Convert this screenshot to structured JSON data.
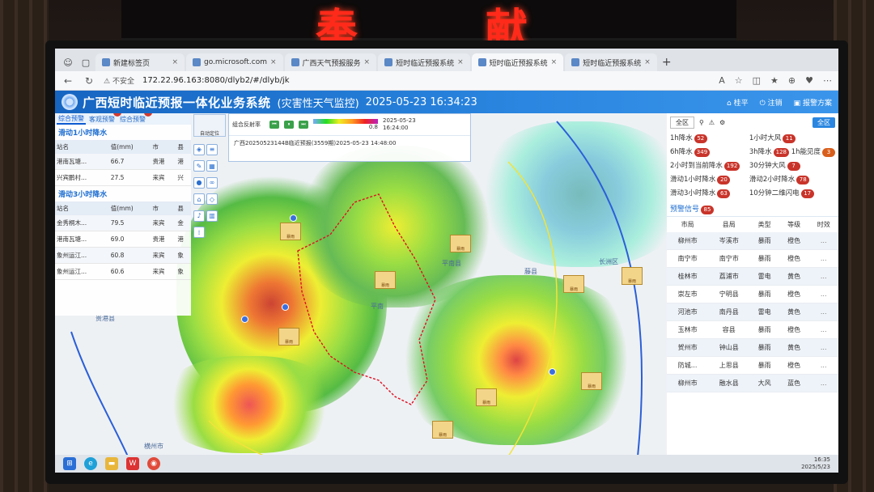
{
  "led": {
    "chars": [
      "奉",
      "献"
    ]
  },
  "browser": {
    "tabs": [
      {
        "label": "新建标签页",
        "active": false
      },
      {
        "label": "go.microsoft.com",
        "active": false
      },
      {
        "label": "广西天气预报服务",
        "active": false
      },
      {
        "label": "短时临近预报系统",
        "active": false
      },
      {
        "label": "短时临近预报系统",
        "active": true
      },
      {
        "label": "短时临近预报系统",
        "active": false
      }
    ],
    "insecure_label": "不安全",
    "url": "172.22.96.163:8080/dlyb2/#/dlyb/jk"
  },
  "header": {
    "title": "广西短时临近预报一体化业务系统",
    "subtitle": "(灾害性天气监控)",
    "datetime": "2025-05-23 16:34:23",
    "right_items": [
      "桂平",
      "注销",
      "报警方案"
    ]
  },
  "left": {
    "tabs": [
      {
        "label": "综合预警",
        "badge": ""
      },
      {
        "label": "客观预警",
        "badge": "0"
      },
      {
        "label": "综合预警",
        "badge": "2"
      }
    ],
    "section1": {
      "title": "滑动1小时降水",
      "columns": [
        "站名",
        "值(mm)",
        "市",
        "县"
      ],
      "rows": [
        [
          "港南瓦塘...",
          "66.7",
          "贵港",
          "港"
        ],
        [
          "兴宾鹏村...",
          "27.5",
          "来宾",
          "兴"
        ]
      ]
    },
    "section2": {
      "title": "滑动3小时降水",
      "columns": [
        "站名",
        "值(mm)",
        "市",
        "县"
      ],
      "rows": [
        [
          "金秀桐木...",
          "79.5",
          "来宾",
          "金"
        ],
        [
          "港南瓦塘...",
          "69.0",
          "贵港",
          "港"
        ],
        [
          "象州运江...",
          "60.8",
          "来宾",
          "象"
        ],
        [
          "象州运江...",
          "60.6",
          "来宾",
          "象"
        ]
      ]
    }
  },
  "radar": {
    "thumb_label": "自动定位",
    "label": "组合反射率",
    "opacity": "0.8",
    "date": "2025-05-23",
    "time": "16:24:00",
    "info": "广西20250523144B临近预报(3559期)2025-05-23 14:48:00"
  },
  "right": {
    "filter_label": "全区",
    "all_button": "全区",
    "warnings": [
      {
        "label": "1h降水",
        "count": "52"
      },
      {
        "label": "1小时大风",
        "count": "11"
      },
      {
        "label": "6h降水",
        "count": "349"
      },
      {
        "label": "3h降水",
        "count": "128"
      },
      {
        "label": "1h能见度",
        "count": "3"
      },
      {
        "label": "2小时到当前降水",
        "count": "192"
      },
      {
        "label": "30分钟大风",
        "count": "7"
      },
      {
        "label": "滑动1小时降水",
        "count": "20"
      },
      {
        "label": "滑动2小时降水",
        "count": "78"
      },
      {
        "label": "滑动3小时降水",
        "count": "63"
      },
      {
        "label": "10分钟二维闪电",
        "count": "17"
      },
      {
        "label": "预警信号",
        "count": "85"
      }
    ],
    "table": {
      "columns": [
        "市局",
        "县局",
        "类型",
        "等级",
        "时效"
      ],
      "rows": [
        [
          "柳州市",
          "岑溪市",
          "暴雨",
          "橙色",
          "..."
        ],
        [
          "南宁市",
          "南宁市",
          "暴雨",
          "橙色",
          "..."
        ],
        [
          "桂林市",
          "荔浦市",
          "雷电",
          "黄色",
          "..."
        ],
        [
          "崇左市",
          "宁明县",
          "暴雨",
          "橙色",
          "..."
        ],
        [
          "河池市",
          "南丹县",
          "雷电",
          "黄色",
          "..."
        ],
        [
          "玉林市",
          "容县",
          "暴雨",
          "橙色",
          "..."
        ],
        [
          "贺州市",
          "钟山县",
          "暴雨",
          "黄色",
          "..."
        ],
        [
          "防城...",
          "上思县",
          "暴雨",
          "橙色",
          "..."
        ],
        [
          "柳州市",
          "融水县",
          "大风",
          "蓝色",
          "..."
        ]
      ]
    }
  },
  "map": {
    "places": [
      "平南县",
      "平南",
      "长洲区",
      "藤县",
      "横州市",
      "贵港县"
    ]
  },
  "taskbar": {
    "time": "16:35",
    "date": "2025/5/23"
  }
}
